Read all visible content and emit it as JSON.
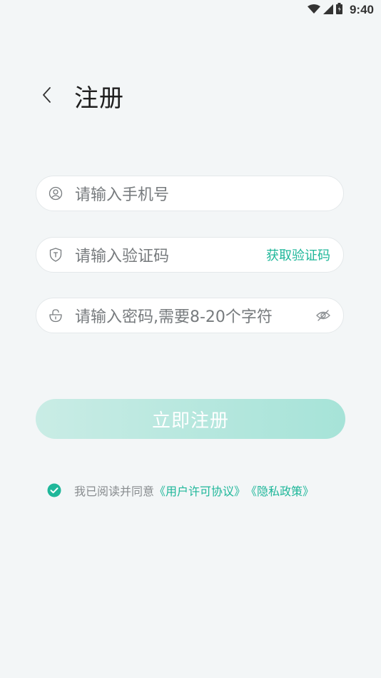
{
  "status_bar": {
    "time": "9:40",
    "icons": [
      "wifi-icon",
      "signal-icon",
      "battery-icon"
    ]
  },
  "header": {
    "back_icon": "chevron-left-icon",
    "title": "注册"
  },
  "form": {
    "phone": {
      "icon": "user-circle-icon",
      "placeholder": "请输入手机号"
    },
    "code": {
      "icon": "shield-icon",
      "placeholder": "请输入验证码",
      "action_label": "获取验证码"
    },
    "password": {
      "icon": "lock-icon",
      "placeholder": "请输入密码,需要8-20个字符",
      "toggle_icon": "eye-off-icon"
    }
  },
  "submit": {
    "label": "立即注册"
  },
  "agreement": {
    "checked": true,
    "prefix": "我已阅读并同意",
    "terms_link": "《用户许可协议》",
    "privacy_link": "《隐私政策》"
  },
  "colors": {
    "accent": "#1fb79a",
    "background": "#f3f6f7",
    "button_gradient_start": "#c9ece5",
    "button_gradient_end": "#a6e3d8"
  }
}
